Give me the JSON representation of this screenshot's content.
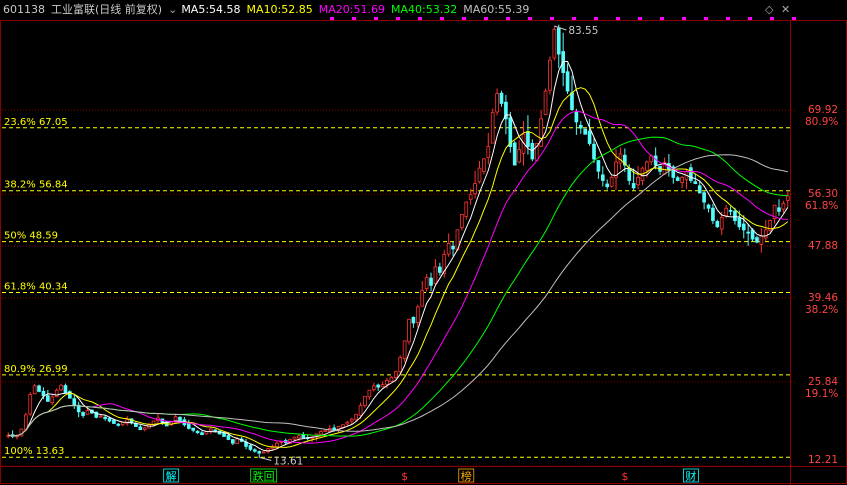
{
  "header": {
    "code": "601138",
    "name": "工业富联",
    "period": "(日线 前复权)",
    "ma": [
      {
        "label": "MA5:",
        "value": "54.58",
        "color": "#ffffff"
      },
      {
        "label": "MA10:",
        "value": "52.85",
        "color": "#ffff00"
      },
      {
        "label": "MA20:",
        "value": "51.69",
        "color": "#ff00ff"
      },
      {
        "label": "MA40:",
        "value": "53.32",
        "color": "#00ff00"
      },
      {
        "label": "MA60:",
        "value": "55.39",
        "color": "#c0c0c0"
      }
    ],
    "icons": [
      "diamond-icon",
      "close-icon"
    ]
  },
  "colors": {
    "up": "#ff3232",
    "down": "#54fcfc",
    "fib": "#ffff00",
    "grid": "#8b0000",
    "axis_text": "#ff4444",
    "peak_label": "#c8c8c8"
  },
  "chart_data": {
    "type": "candlestick",
    "title": "",
    "ylim": [
      12.21,
      83.55
    ],
    "high": 83.55,
    "low": 13.61,
    "high_label": "83.55",
    "low_label": "13.61",
    "fib_levels": [
      {
        "label": "23.6% 67.05",
        "value": 67.05
      },
      {
        "label": "38.2% 56.84",
        "value": 56.84
      },
      {
        "label": "50% 48.59",
        "value": 48.59
      },
      {
        "label": "61.8% 40.34",
        "value": 40.34
      },
      {
        "label": "80.9% 26.99",
        "value": 26.99
      },
      {
        "label": "100% 13.63",
        "value": 13.63
      }
    ],
    "right_axis": [
      {
        "price": "69.92",
        "pct": "80.9%",
        "value": 69.92
      },
      {
        "price": "56.30",
        "pct": "61.8%",
        "value": 56.3
      },
      {
        "price": "47.88",
        "pct": "",
        "value": 47.88
      },
      {
        "price": "39.46",
        "pct": "38.2%",
        "value": 39.46
      },
      {
        "price": "25.84",
        "pct": "19.1%",
        "value": 25.84
      },
      {
        "price": "12.21",
        "pct": "",
        "value": 12.21
      }
    ],
    "events": [
      {
        "label": "解",
        "color": "#00ffff",
        "bar": 37
      },
      {
        "label": "跌回",
        "color": "#00ff00",
        "bar": 58
      },
      {
        "label": "$",
        "color": "#ff3232",
        "bar": 90
      },
      {
        "label": "榜",
        "color": "#ffaa00",
        "bar": 104
      },
      {
        "label": "$",
        "color": "#ff3232",
        "bar": 140
      },
      {
        "label": "财",
        "color": "#00ffff",
        "bar": 155
      }
    ],
    "ma_series": [
      {
        "name": "MA5",
        "color": "#ffffff",
        "period": 5
      },
      {
        "name": "MA10",
        "color": "#ffff00",
        "period": 10
      },
      {
        "name": "MA20",
        "color": "#ff00ff",
        "period": 20
      },
      {
        "name": "MA40",
        "color": "#00ff00",
        "period": 40
      },
      {
        "name": "MA60",
        "color": "#c0c0c0",
        "period": 60
      }
    ],
    "closes": [
      17.2,
      17.0,
      17.1,
      18.2,
      20.5,
      23.8,
      25.2,
      24.3,
      23.6,
      22.7,
      23.4,
      24.5,
      25.3,
      24.1,
      23.2,
      22.1,
      21.0,
      20.4,
      21.2,
      20.8,
      20.1,
      20.3,
      19.9,
      19.5,
      19.1,
      18.8,
      19.3,
      19.7,
      19.2,
      18.6,
      18.1,
      18.4,
      18.9,
      19.5,
      20.0,
      19.3,
      18.7,
      19.4,
      20.2,
      19.6,
      18.9,
      18.3,
      18.0,
      17.6,
      17.3,
      17.8,
      18.2,
      17.9,
      17.4,
      17.0,
      16.5,
      15.9,
      16.6,
      16.2,
      15.4,
      14.9,
      14.6,
      14.3,
      14.5,
      15.0,
      15.4,
      15.9,
      16.2,
      16.0,
      16.5,
      16.9,
      17.1,
      16.8,
      16.7,
      16.9,
      17.4,
      17.8,
      18.0,
      18.3,
      18.1,
      18.6,
      18.9,
      19.3,
      19.8,
      20.6,
      22.0,
      23.5,
      24.5,
      25.2,
      25.0,
      25.4,
      26.1,
      26.6,
      27.5,
      29.8,
      32.5,
      36.0,
      35.4,
      38.0,
      40.7,
      42.8,
      41.5,
      44.5,
      43.6,
      46.5,
      48.3,
      47.4,
      50.5,
      53.0,
      55.0,
      56.2,
      58.0,
      60.5,
      62.0,
      64.0,
      69.5,
      72.6,
      71.0,
      68.5,
      64.0,
      61.0,
      63.5,
      66.0,
      64.0,
      62.0,
      64.5,
      68.5,
      73.0,
      78.0,
      83.0,
      79.0,
      76.0,
      73.0,
      70.0,
      68.0,
      67.0,
      66.0,
      64.5,
      62.0,
      60.0,
      58.5,
      57.5,
      59.0,
      61.5,
      62.8,
      61.0,
      58.5,
      57.3,
      59.0,
      60.5,
      61.5,
      62.5,
      61.0,
      60.0,
      61.4,
      60.2,
      59.0,
      58.5,
      59.0,
      60.0,
      58.5,
      58.0,
      56.5,
      55.0,
      54.0,
      52.0,
      51.0,
      52.5,
      54.0,
      53.5,
      52.0,
      51.0,
      50.5,
      50.0,
      49.0,
      48.5,
      49.5,
      50.5,
      52.0,
      54.5,
      53.5,
      54.8,
      56.0
    ]
  }
}
